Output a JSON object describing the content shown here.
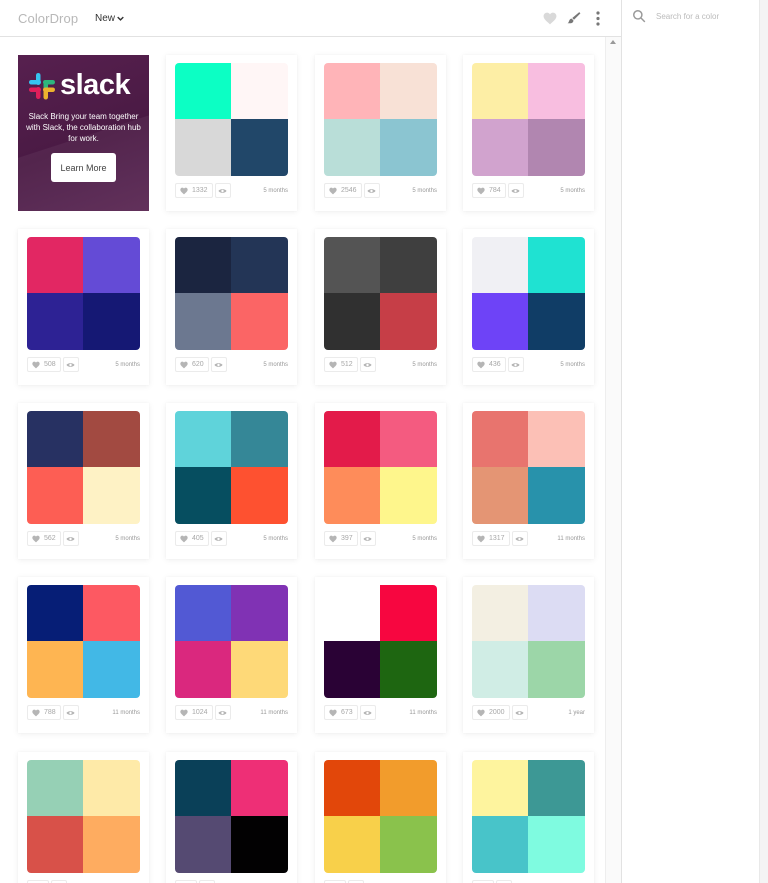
{
  "app": {
    "brand": "ColorDrop",
    "sort_label": "New"
  },
  "header_icons": [
    "heart-icon",
    "brush-icon",
    "more-vertical-icon"
  ],
  "search": {
    "placeholder": "Search for a color"
  },
  "ad": {
    "logo_text": "slack",
    "copy": "Slack Bring your team together with Slack, the collaboration hub for work.",
    "cta": "Learn More"
  },
  "palettes": [
    {
      "colors": [
        "#0cffc4",
        "#fff6f6",
        "#d8d8d8",
        "#214769"
      ],
      "likes": "1332",
      "age": "5 months"
    },
    {
      "colors": [
        "#ffb4b8",
        "#f8e1d6",
        "#b9ded8",
        "#8bc5d1"
      ],
      "likes": "2546",
      "age": "5 months"
    },
    {
      "colors": [
        "#fdeea5",
        "#f8bee0",
        "#d1a3ce",
        "#b186b0"
      ],
      "likes": "784",
      "age": "5 months"
    },
    {
      "colors": [
        "#e22763",
        "#644bd6",
        "#2d2294",
        "#151874"
      ],
      "likes": "508",
      "age": "5 months"
    },
    {
      "colors": [
        "#1b2540",
        "#233556",
        "#6c7890",
        "#fb6565"
      ],
      "likes": "620",
      "age": "5 months"
    },
    {
      "colors": [
        "#545454",
        "#3f3f3f",
        "#303030",
        "#c63e47"
      ],
      "likes": "512",
      "age": "5 months"
    },
    {
      "colors": [
        "#f0f0f4",
        "#1fe2d2",
        "#6e43f7",
        "#103d66"
      ],
      "likes": "436",
      "age": "5 months"
    },
    {
      "colors": [
        "#273162",
        "#a24a41",
        "#fd5e54",
        "#fef2c5"
      ],
      "likes": "562",
      "age": "5 months"
    },
    {
      "colors": [
        "#5fd3da",
        "#358797",
        "#064e60",
        "#fe5130"
      ],
      "likes": "405",
      "age": "5 months"
    },
    {
      "colors": [
        "#e31b4a",
        "#f45b80",
        "#fe8c5a",
        "#fef68c"
      ],
      "likes": "397",
      "age": "5 months"
    },
    {
      "colors": [
        "#e8746e",
        "#fcc0b6",
        "#e49574",
        "#2892ab"
      ],
      "likes": "1317",
      "age": "11 months"
    },
    {
      "colors": [
        "#061e76",
        "#fd5962",
        "#feb552",
        "#42b8e6"
      ],
      "likes": "788",
      "age": "11 months"
    },
    {
      "colors": [
        "#5259d4",
        "#8032b4",
        "#da287e",
        "#fed978"
      ],
      "likes": "1024",
      "age": "11 months"
    },
    {
      "colors": [
        "#ffffff",
        "#f70640",
        "#2a0235",
        "#1e6611"
      ],
      "likes": "673",
      "age": "11 months"
    },
    {
      "colors": [
        "#f3efe2",
        "#dcdcf3",
        "#d0ede5",
        "#9cd6a8"
      ],
      "likes": "2000",
      "age": "1 year"
    },
    {
      "colors": [
        "#96d0b5",
        "#feeaa8",
        "#d85149",
        "#feac60"
      ],
      "likes": "",
      "age": ""
    },
    {
      "colors": [
        "#0a4058",
        "#ee2f76",
        "#554a72",
        "#020102"
      ],
      "likes": "",
      "age": ""
    },
    {
      "colors": [
        "#e2470a",
        "#f29c2c",
        "#f8d04a",
        "#8ac24c"
      ],
      "likes": "",
      "age": ""
    },
    {
      "colors": [
        "#fef49e",
        "#3d9895",
        "#48c4c9",
        "#7ffbe0"
      ],
      "likes": "",
      "age": ""
    }
  ]
}
